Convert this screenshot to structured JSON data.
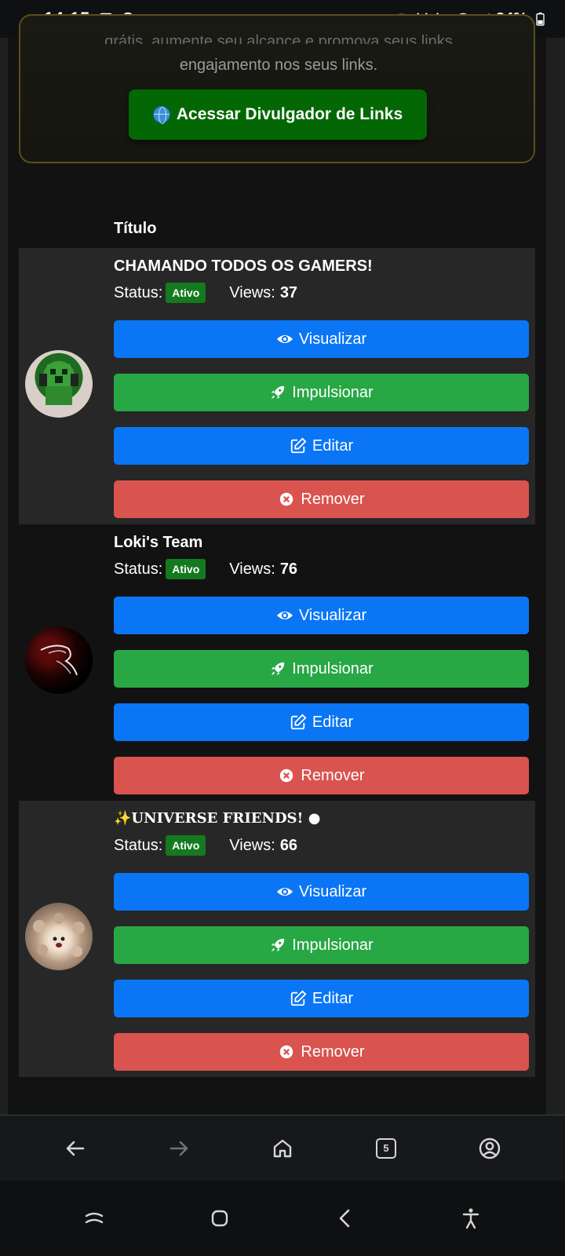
{
  "status_bar": {
    "time": "14:15",
    "battery": "34%"
  },
  "banner": {
    "text_top": "grátis, aumente seu alcance e promova seus links",
    "text": "engajamento nos seus links.",
    "button_label": "Acessar Divulgador de Links"
  },
  "table": {
    "header_title": "Título"
  },
  "labels": {
    "status": "Status:",
    "views": "Views:",
    "view_btn": "Visualizar",
    "boost_btn": "Impulsionar",
    "edit_btn": "Editar",
    "remove_btn": "Remover"
  },
  "rows": [
    {
      "title": "CHAMANDO TODOS OS GAMERS!",
      "status": "Ativo",
      "views": "37"
    },
    {
      "title": "Loki's Team",
      "status": "Ativo",
      "views": "76"
    },
    {
      "title": "✨UNIVERSE FRIENDS! ●",
      "status": "Ativo",
      "views": "66"
    }
  ],
  "browser": {
    "tab_count": "5"
  },
  "colors": {
    "primary": "#0a76f6",
    "success": "#28a745",
    "danger": "#d9534f",
    "badge": "#157a1f",
    "banner_button": "#036803"
  }
}
